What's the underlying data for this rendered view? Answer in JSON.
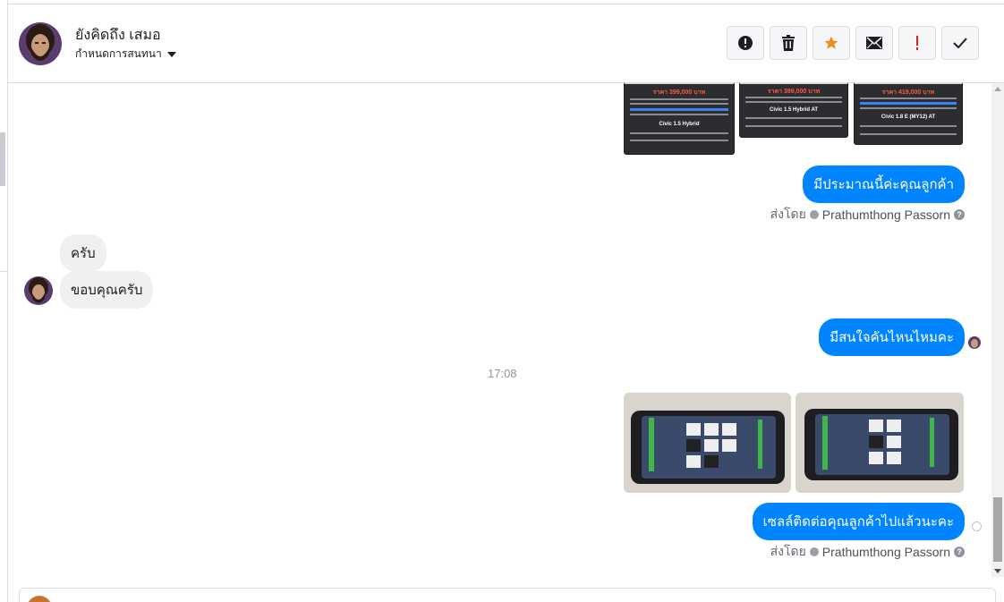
{
  "header": {
    "contact_name": "ยังคิดถึง เสมอ",
    "assign_label": "กำหนดการสนทนา"
  },
  "actions": [
    {
      "name": "alert-icon",
      "color": "#1c1e21"
    },
    {
      "name": "trash-icon",
      "color": "#1c1e21"
    },
    {
      "name": "star-icon",
      "color": "#f28a1c"
    },
    {
      "name": "envelope-icon",
      "color": "#1c1e21"
    },
    {
      "name": "exclamation-icon",
      "color": "#e02020"
    },
    {
      "name": "check-icon",
      "color": "#1c1e21"
    }
  ],
  "thread": {
    "listing_cards": [
      {
        "price": "ราคา 399,000 บาท",
        "model": "Civic 1.5 Hybrid"
      },
      {
        "price": "ราคา 399,000 บาท",
        "model": "Civic 1.5 Hybrid AT"
      },
      {
        "price": "ราคา 419,000 บาท",
        "model": "Civic 1.8 E (MY12) AT"
      }
    ],
    "msg_out_1": "มีประมาณนี้ค่ะคุณลูกค้า",
    "sent_by_label_1": "ส่งโดย",
    "sent_by_name_1": "Prathumthong Passorn",
    "msg_in_1": "ครับ",
    "msg_in_2": "ขอบคุณครับ",
    "msg_out_2": "มีสนใจคันไหนไหมคะ",
    "timestamp": "17:08",
    "msg_out_3": "เซลล์ติดต่อคุณลูกค้าไปแล้วนะคะ",
    "sent_by_label_2": "ส่งโดย",
    "sent_by_name_2": "Prathumthong Passorn"
  },
  "colors": {
    "accent": "#0084ff",
    "incoming_bubble": "#f0f0f0"
  }
}
